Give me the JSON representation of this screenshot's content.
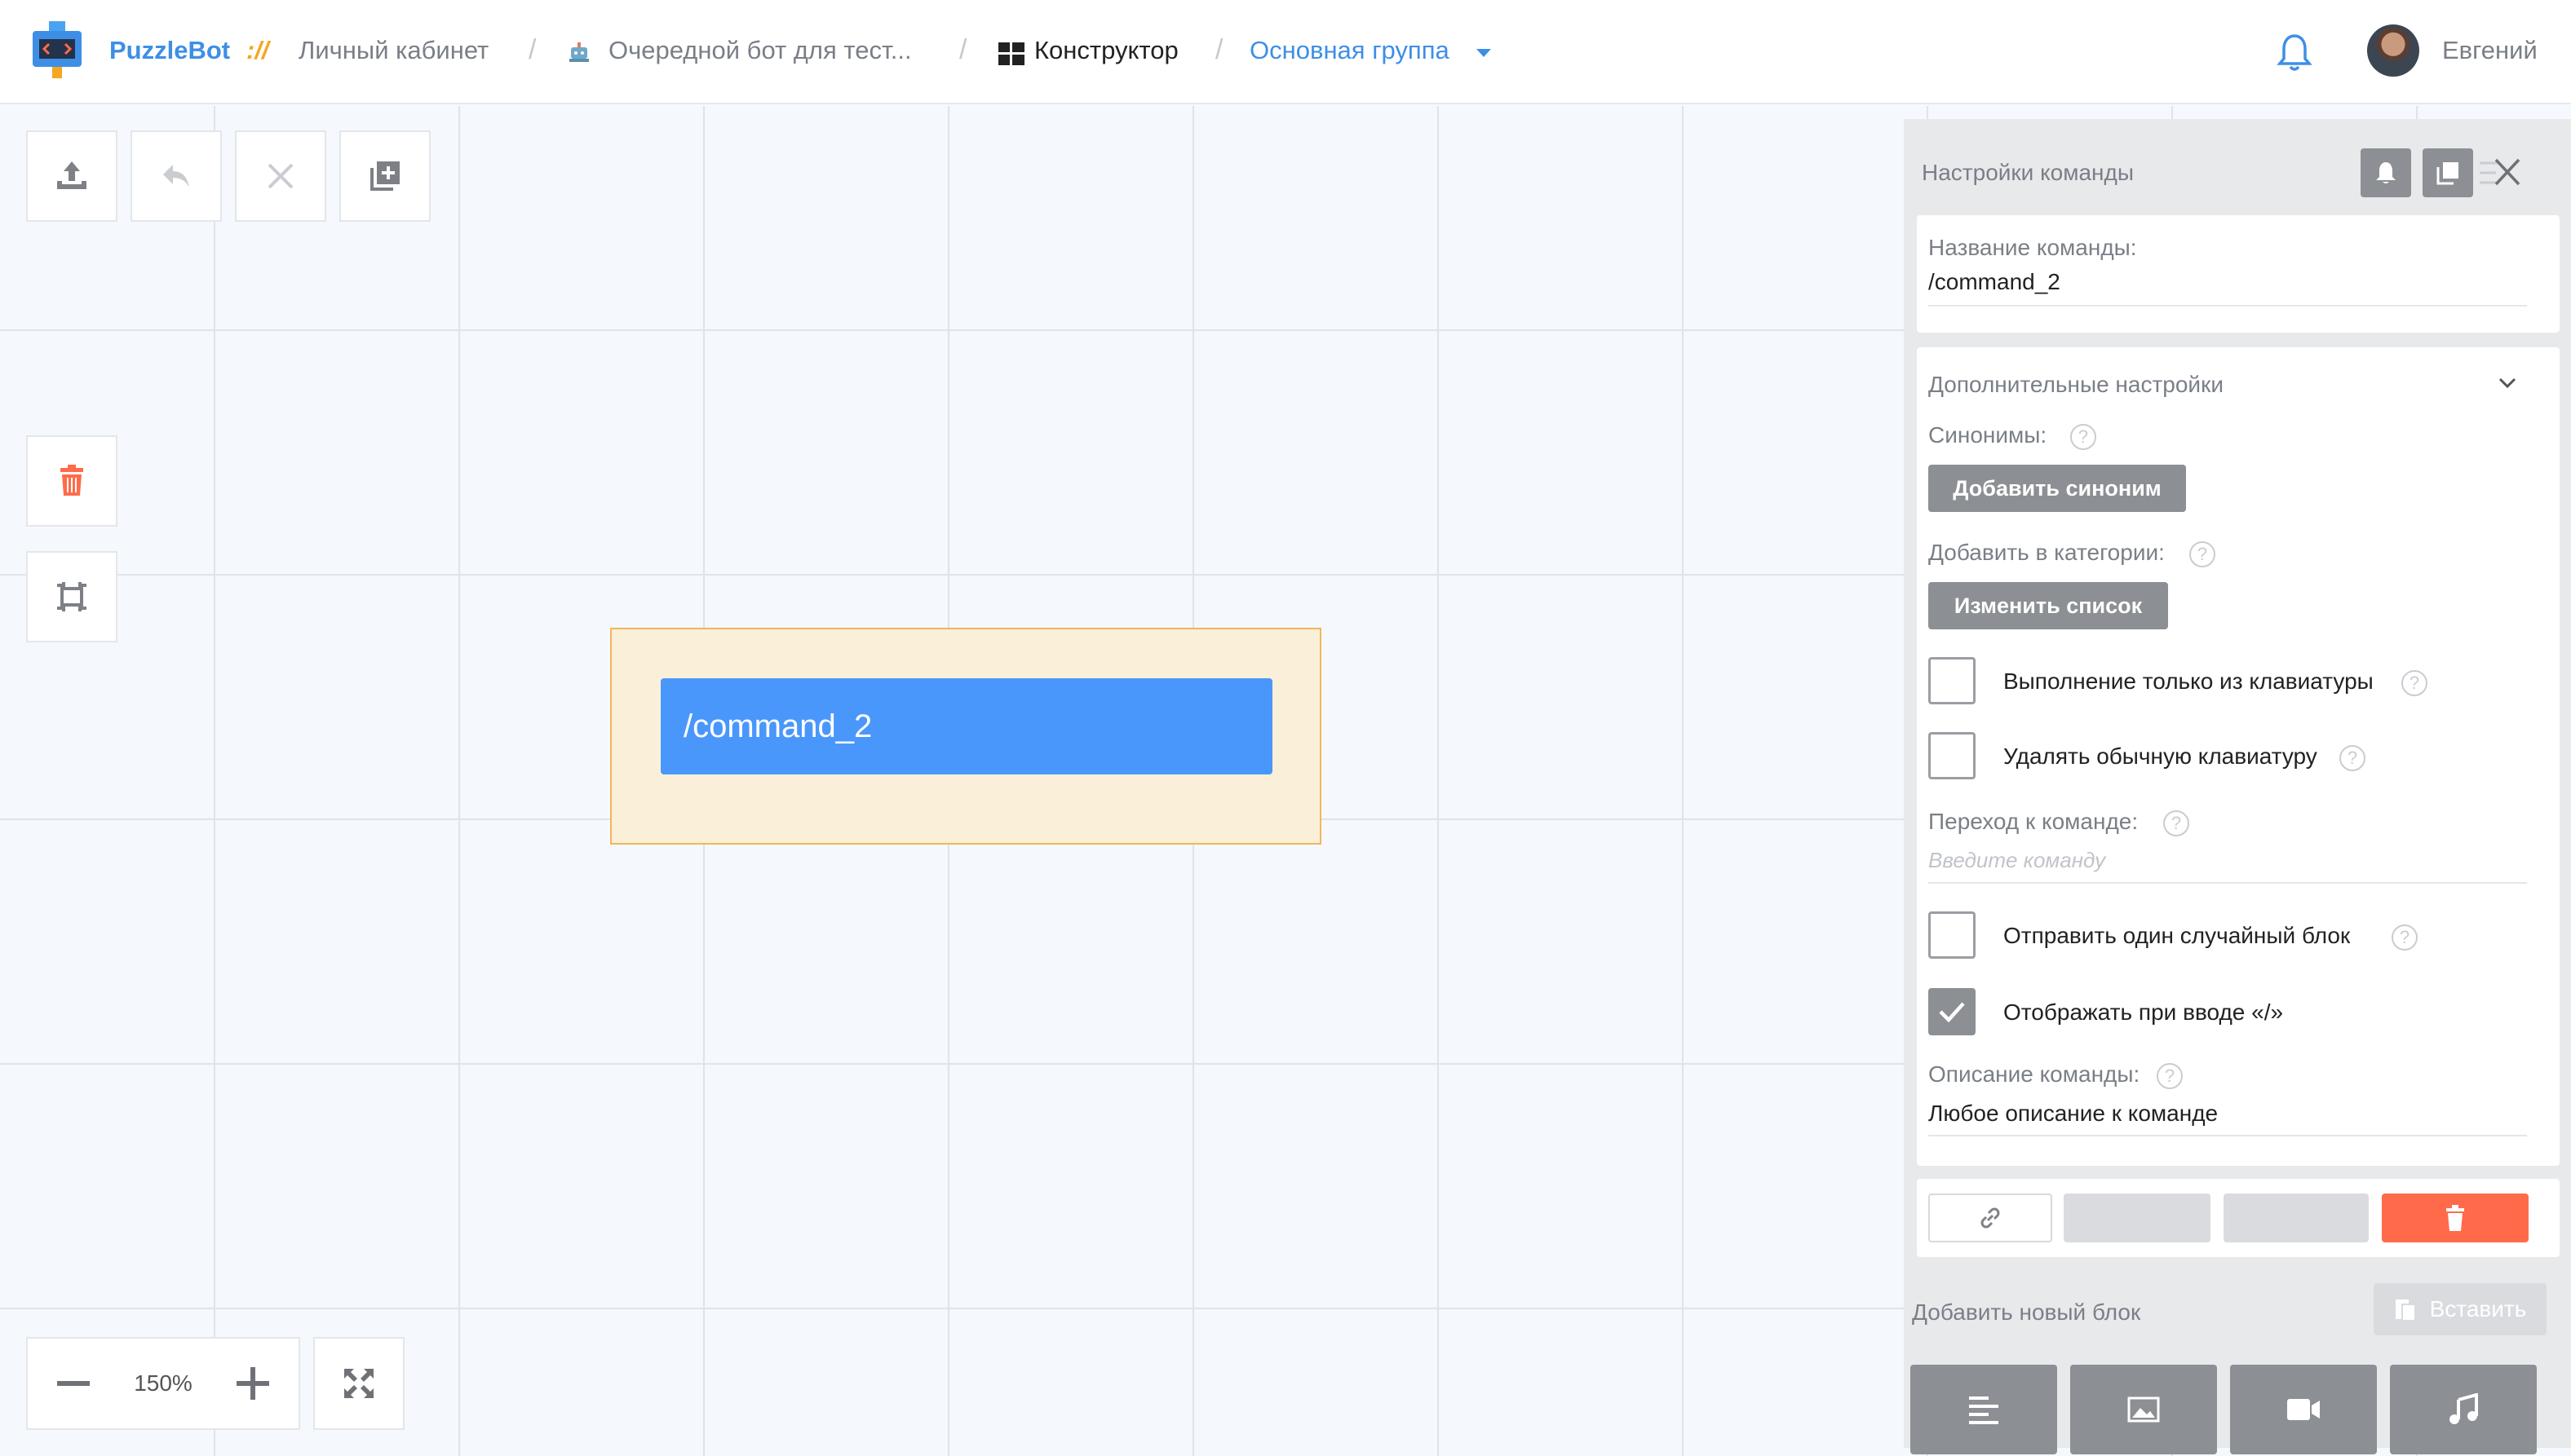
{
  "header": {
    "brand": "PuzzleBot",
    "brand_sep": "://",
    "breadcrumbs": [
      {
        "label": "Личный кабинет"
      },
      {
        "label": "Очередной бот для тест..."
      },
      {
        "label": "Конструктор"
      },
      {
        "label": "Основная группа"
      }
    ],
    "user_name": "Евгений"
  },
  "toolbar": {
    "icons": [
      "upload-icon",
      "undo-icon",
      "close-icon",
      "add-copy-icon"
    ],
    "side_icons": [
      "trash-icon",
      "fit-frame-icon"
    ]
  },
  "zoom": {
    "value": "150%"
  },
  "canvas": {
    "command_block": "/command_2"
  },
  "panel": {
    "title": "Настройки команды",
    "name_label": "Название команды:",
    "name_value": "/command_2",
    "extra_title": "Дополнительные настройки",
    "synonyms_label": "Синонимы:",
    "add_synonym_btn": "Добавить синоним",
    "categories_label": "Добавить в категории:",
    "change_list_btn": "Изменить список",
    "checkboxes": [
      {
        "label": "Выполнение только из клавиатуры",
        "checked": false
      },
      {
        "label": "Удалять обычную клавиатуру",
        "checked": false
      }
    ],
    "goto_label": "Переход к команде:",
    "goto_placeholder": "Введите команду",
    "checkboxes2": [
      {
        "label": "Отправить один случайный блок",
        "checked": false
      },
      {
        "label": "Отображать при вводе «/»",
        "checked": true
      }
    ],
    "desc_label": "Описание команды:",
    "desc_value": "Любое описание к команде",
    "add_block_label": "Добавить новый блок",
    "paste_btn": "Вставить",
    "block_types": [
      "text-icon",
      "image-icon",
      "video-icon",
      "music-icon"
    ]
  },
  "colors": {
    "accent": "#3d8fe6",
    "command_blue": "#4a97fb",
    "delete_red": "#ff6b4a",
    "brand_orange": "#f5a623"
  }
}
